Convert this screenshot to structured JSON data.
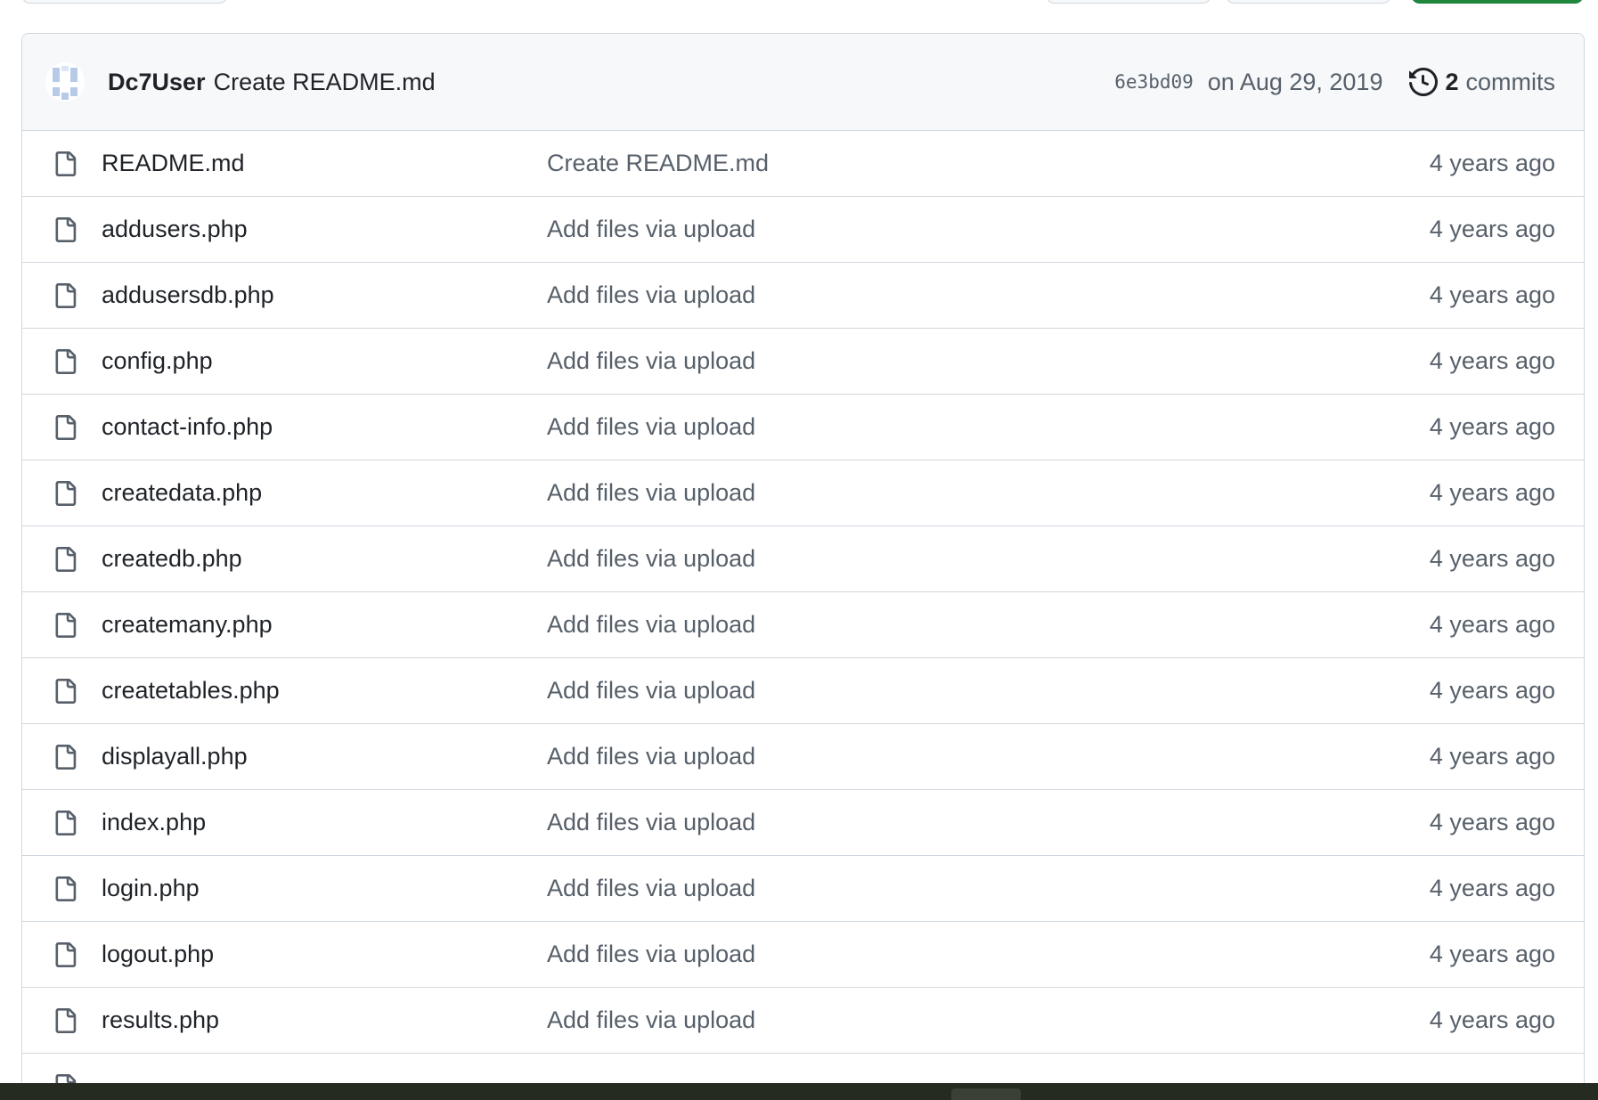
{
  "commit": {
    "author": "Dc7User",
    "message": "Create README.md",
    "sha": "6e3bd09",
    "date": "on Aug 29, 2019",
    "commit_count": "2",
    "commits_label": "commits"
  },
  "files": [
    {
      "name": "README.md",
      "message": "Create README.md",
      "age": "4 years ago"
    },
    {
      "name": "addusers.php",
      "message": "Add files via upload",
      "age": "4 years ago"
    },
    {
      "name": "addusersdb.php",
      "message": "Add files via upload",
      "age": "4 years ago"
    },
    {
      "name": "config.php",
      "message": "Add files via upload",
      "age": "4 years ago"
    },
    {
      "name": "contact-info.php",
      "message": "Add files via upload",
      "age": "4 years ago"
    },
    {
      "name": "createdata.php",
      "message": "Add files via upload",
      "age": "4 years ago"
    },
    {
      "name": "createdb.php",
      "message": "Add files via upload",
      "age": "4 years ago"
    },
    {
      "name": "createmany.php",
      "message": "Add files via upload",
      "age": "4 years ago"
    },
    {
      "name": "createtables.php",
      "message": "Add files via upload",
      "age": "4 years ago"
    },
    {
      "name": "displayall.php",
      "message": "Add files via upload",
      "age": "4 years ago"
    },
    {
      "name": "index.php",
      "message": "Add files via upload",
      "age": "4 years ago"
    },
    {
      "name": "login.php",
      "message": "Add files via upload",
      "age": "4 years ago"
    },
    {
      "name": "logout.php",
      "message": "Add files via upload",
      "age": "4 years ago"
    },
    {
      "name": "results.php",
      "message": "Add files via upload",
      "age": "4 years ago"
    },
    {
      "name": "",
      "message": "",
      "age": ""
    }
  ],
  "icons": {
    "file": "file-icon",
    "history": "history-icon",
    "avatar": "identicon-avatar"
  },
  "colors": {
    "header_bg": "#f6f8fa",
    "border": "#d0d7de",
    "muted_text": "#57606a",
    "primary_text": "#1f2328",
    "code_button": "#1f883d"
  }
}
